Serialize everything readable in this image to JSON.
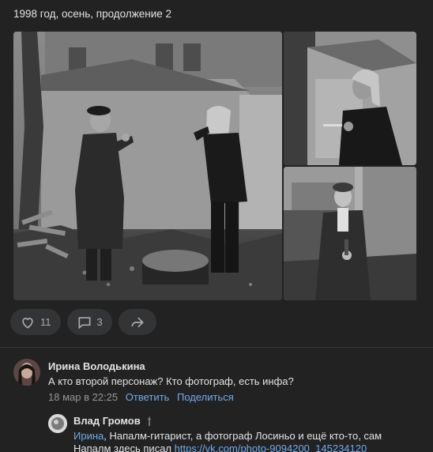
{
  "post": {
    "text": "1998 год, осень, продолжение 2"
  },
  "photos": [
    {
      "name": "main-photo",
      "alt": ""
    },
    {
      "name": "top-right-photo",
      "alt": ""
    },
    {
      "name": "bottom-right-photo",
      "alt": ""
    }
  ],
  "actions": {
    "like_icon": "heart-icon",
    "like_count": "11",
    "comment_icon": "comment-icon",
    "comment_count": "3",
    "share_icon": "share-icon"
  },
  "comment": {
    "author": "Ирина Володькина",
    "text": "А кто второй персонаж? Кто фотограф, есть инфа?",
    "date": "18 мар в 22:25",
    "reply_label": "Ответить",
    "share_label": "Поделиться"
  },
  "reply": {
    "author": "Влад Громов",
    "mention": "Ирина",
    "text_after_mention": ", Напалм-гитарист, а фотограф Лосиньо и ещё кто-то, сам",
    "text_line2": "Напалм здесь писал ",
    "link": "https://vk.com/photo-9094200_145234120"
  },
  "colors": {
    "background": "#222222",
    "link": "#71aaeb",
    "button_bg": "#333436",
    "muted": "#939599"
  }
}
